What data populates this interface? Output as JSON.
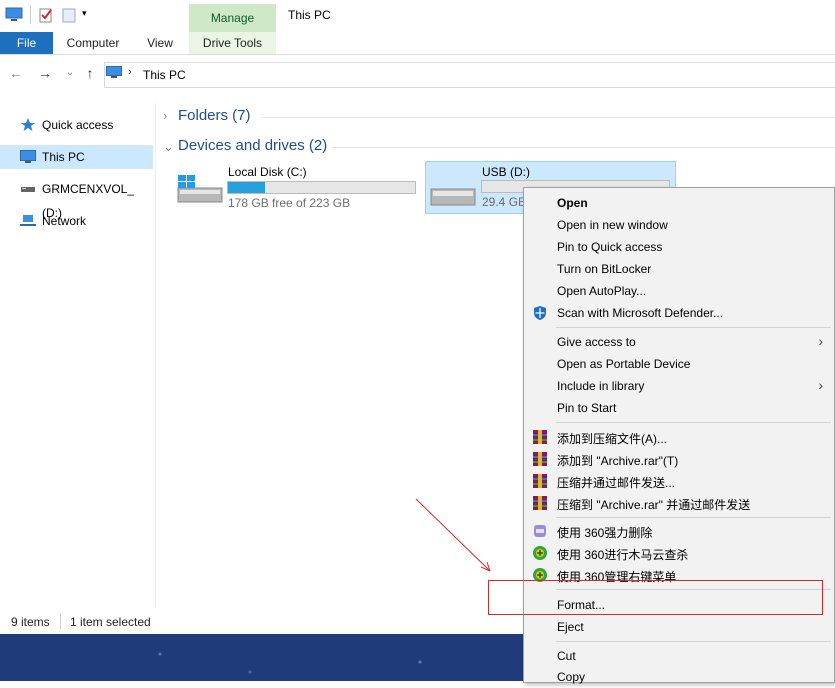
{
  "window": {
    "title": "This PC",
    "contextual_tab": "Manage"
  },
  "tabs": [
    "File",
    "Computer",
    "View",
    "Drive Tools"
  ],
  "address": {
    "path": "This PC"
  },
  "sidebar": {
    "items": [
      {
        "label": "Quick access"
      },
      {
        "label": "This PC"
      },
      {
        "label": "GRMCENXVOL_ (D:)"
      },
      {
        "label": "Network"
      }
    ]
  },
  "groups": {
    "folders": "Folders (7)",
    "devices": "Devices and drives (2)"
  },
  "drives": [
    {
      "name": "Local Disk (C:)",
      "free": "178 GB free of 223 GB",
      "used_fraction": 0.2
    },
    {
      "name": "USB (D:)",
      "free": "29.4 GB",
      "used_fraction": 0.0
    }
  ],
  "status": {
    "items": "9 items",
    "selected": "1 item selected"
  },
  "context_menu": {
    "items": [
      "Open",
      "Open in new window",
      "Pin to Quick access",
      "Turn on BitLocker",
      "Open AutoPlay...",
      "Scan with Microsoft Defender...",
      "Give access to",
      "Open as Portable Device",
      "Include in library",
      "Pin to Start",
      "添加到压缩文件(A)...",
      "添加到 \"Archive.rar\"(T)",
      "压缩并通过邮件发送...",
      "压缩到 \"Archive.rar\" 并通过邮件发送",
      "使用 360强力删除",
      "使用 360进行木马云查杀",
      "使用 360管理右键菜单",
      "Format...",
      "Eject",
      "Cut",
      "Copy"
    ]
  },
  "colors": {
    "accent": "#1f6fbf",
    "selection": "#cce8ff",
    "annotation": "#d42a2a"
  }
}
